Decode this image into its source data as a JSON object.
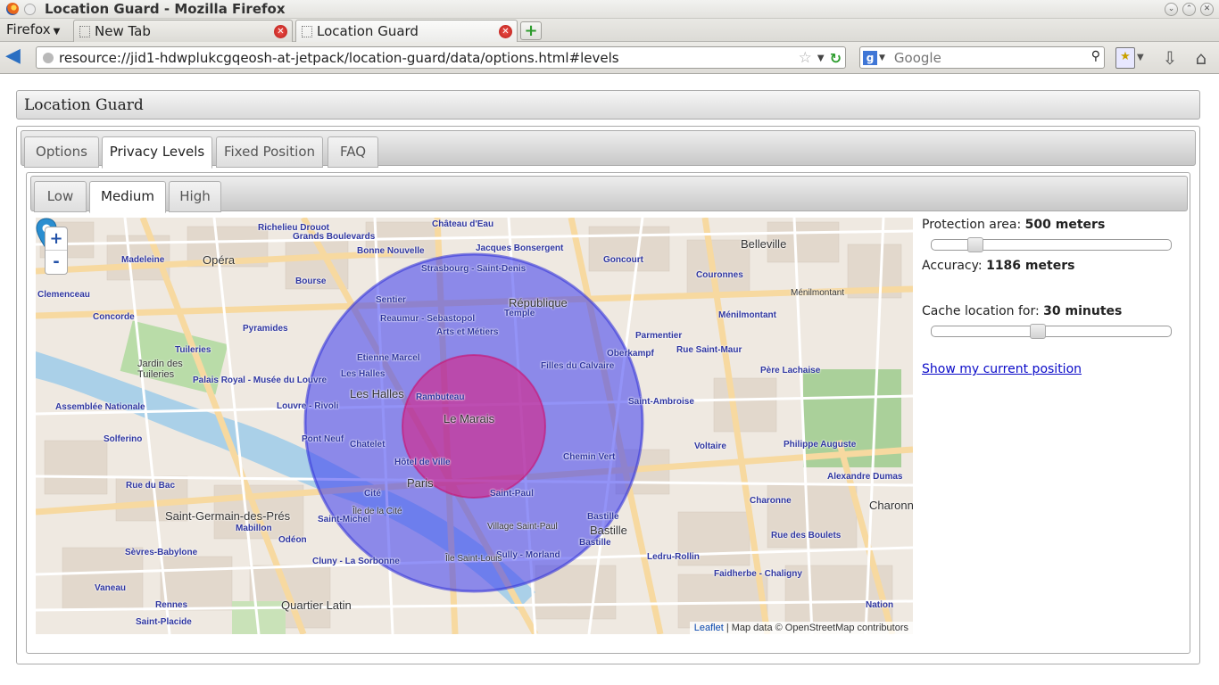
{
  "window": {
    "title": "Location Guard - Mozilla Firefox"
  },
  "browser": {
    "menu_label": "Firefox",
    "tabs": [
      {
        "label": "New Tab"
      },
      {
        "label": "Location Guard"
      }
    ],
    "url": "resource://jid1-hdwplukcgqeosh-at-jetpack/location-guard/data/options.html#levels",
    "search_placeholder": "Google"
  },
  "app": {
    "header": "Location Guard",
    "main_tabs": [
      {
        "label": "Options"
      },
      {
        "label": "Privacy Levels"
      },
      {
        "label": "Fixed Position"
      },
      {
        "label": "FAQ"
      }
    ],
    "sub_tabs": [
      {
        "label": "Low"
      },
      {
        "label": "Medium"
      },
      {
        "label": "High"
      }
    ],
    "settings": {
      "protection_label": "Protection area:",
      "protection_value": "500 meters",
      "protection_slider_fraction": 0.16,
      "accuracy_label": "Accuracy:",
      "accuracy_value": "1186 meters",
      "cache_label": "Cache location for:",
      "cache_value": "30 minutes",
      "cache_slider_fraction": 0.44,
      "show_position_link": "Show my current position"
    }
  },
  "map": {
    "zoom_in": "+",
    "zoom_out": "-",
    "attribution_link": "Leaflet",
    "attribution_text": "| Map data © OpenStreetMap contributors",
    "labels": {
      "le_marais": "Le Marais",
      "paris": "Paris",
      "les_halles": "Les Halles",
      "republique": "République",
      "opera": "Opéra",
      "belleville": "Belleville",
      "bastille": "Bastille",
      "quartier_latin": "Quartier Latin",
      "st_germain": "Saint-Germain-des-Prés",
      "charonne": "Charonne",
      "jardin_tuileries": "Jardin des Tuileries",
      "strasbourg": "Strasbourg - Saint-Denis",
      "arts_metiers": "Arts et Métiers",
      "reaumur": "Reaumur - Sebastopol",
      "etienne_marcel": "Etienne Marcel",
      "hotel_de_ville": "Hôtel de Ville",
      "saint_paul": "Saint-Paul",
      "chemin_vert": "Chemin Vert",
      "filles_calvaire": "Filles du Calvaire",
      "oberkampf": "Oberkampf",
      "saint_ambroise": "Saint-Ambroise",
      "voltaire": "Voltaire",
      "pont_neuf": "Pont Neuf",
      "chatelet": "Chatelet",
      "louvre_rivoli": "Louvre - Rivoli",
      "palais_royal": "Palais Royal - Musée du Louvre",
      "pyramides": "Pyramides",
      "tuileries": "Tuileries",
      "concorde": "Concorde",
      "madeleine": "Madeleine",
      "bourse": "Bourse",
      "sentier": "Sentier",
      "temple": "Temple",
      "goncourt": "Goncourt",
      "parmentier": "Parmentier",
      "pere_lachaise": "Père Lachaise",
      "philippe_auguste": "Philippe Auguste",
      "alexandre_dumas": "Alexandre Dumas",
      "ledru_rollin": "Ledru-Rollin",
      "sully_morland": "Sully - Morland",
      "cite": "Cité",
      "saint_michel": "Saint-Michel",
      "odeon": "Odéon",
      "mabillon": "Mabillon",
      "solferino": "Solferino",
      "rue_du_bac": "Rue du Bac",
      "cluny": "Cluny - La Sorbonne",
      "menilmontant": "Ménilmontant",
      "rue_saint_maur": "Rue Saint-Maur",
      "couronnes": "Couronnes",
      "charonne_st": "Charonne",
      "rue_des_boulets": "Rue des Boulets",
      "faidherbe": "Faidherbe - Chaligny",
      "nation": "Nation",
      "richelieu": "Richelieu Drouot",
      "grands_boulevards": "Grands Boulevards",
      "bonne_nouvelle": "Bonne Nouvelle",
      "chateau_deau": "Château d'Eau",
      "jacques_bonsergent": "Jacques Bonsergent",
      "rambuteau": "Rambuteau",
      "les_halles_st": "Les Halles",
      "assemblee": "Assemblée Nationale",
      "sevres_babylone": "Sèvres-Babylone",
      "vaneau": "Vaneau",
      "rennes": "Rennes",
      "saint_placide": "Saint-Placide",
      "village_st_paul": "Village Saint-Paul",
      "ile_st_louis": "Île Saint-Louis",
      "ile_cite": "Île de la Cité",
      "clemenceau": "Clemenceau"
    }
  }
}
